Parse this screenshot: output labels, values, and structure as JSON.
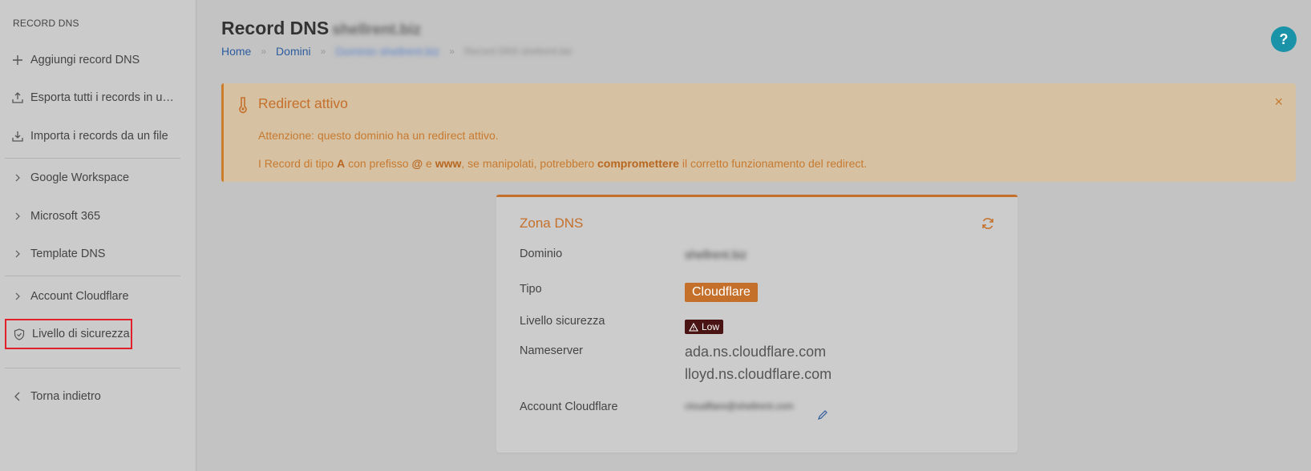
{
  "sidebar": {
    "heading": "RECORD DNS",
    "items": [
      {
        "label": "Aggiungi record DNS",
        "icon": "plus-icon"
      },
      {
        "label": "Esporta tutti i records in un file",
        "icon": "export-icon"
      },
      {
        "label": "Importa i records da un file",
        "icon": "import-icon"
      },
      {
        "label": "Google Workspace",
        "icon": "chevron-right-icon"
      },
      {
        "label": "Microsoft 365",
        "icon": "chevron-right-icon"
      },
      {
        "label": "Template DNS",
        "icon": "chevron-right-icon"
      },
      {
        "label": "Account Cloudflare",
        "icon": "chevron-right-icon"
      },
      {
        "label": "Livello di sicurezza",
        "icon": "shield-icon"
      },
      {
        "label": "Torna indietro",
        "icon": "chevron-left-icon"
      }
    ]
  },
  "header": {
    "title": "Record DNS",
    "title_domain": "shellrent.biz",
    "help_label": "?"
  },
  "breadcrumb": {
    "home": "Home",
    "domini": "Domini",
    "domain": "Dominio shellrent.biz",
    "current": "Record DNS shellrent.biz",
    "separator": "»"
  },
  "alert": {
    "title": "Redirect attivo",
    "line1": "Attenzione: questo dominio ha un redirect attivo.",
    "line2_parts": {
      "p1": "I Record di tipo ",
      "b1": "A",
      "p2": " con prefisso ",
      "b2": "@",
      "p3": " e ",
      "b3": "www",
      "p4": ", se manipolati, potrebbero ",
      "b4": "compromettere",
      "p5": " il corretto funzionamento del redirect."
    },
    "close": "×"
  },
  "zone": {
    "title": "Zona DNS",
    "rows": {
      "dominio_label": "Dominio",
      "dominio_value": "shellrent.biz",
      "tipo_label": "Tipo",
      "tipo_value": "Cloudflare",
      "sicurezza_label": "Livello sicurezza",
      "sicurezza_value": "Low",
      "nameserver_label": "Nameserver",
      "nameservers": [
        "ada.ns.cloudflare.com",
        "lloyd.ns.cloudflare.com"
      ],
      "account_label": "Account Cloudflare",
      "account_value": "cloudflare@shellrent.com"
    }
  },
  "colors": {
    "accent": "#c5702a",
    "link": "#2d5c9e",
    "help": "#1a93a8",
    "danger_badge": "#4a1414",
    "highlight": "#e0202a"
  }
}
